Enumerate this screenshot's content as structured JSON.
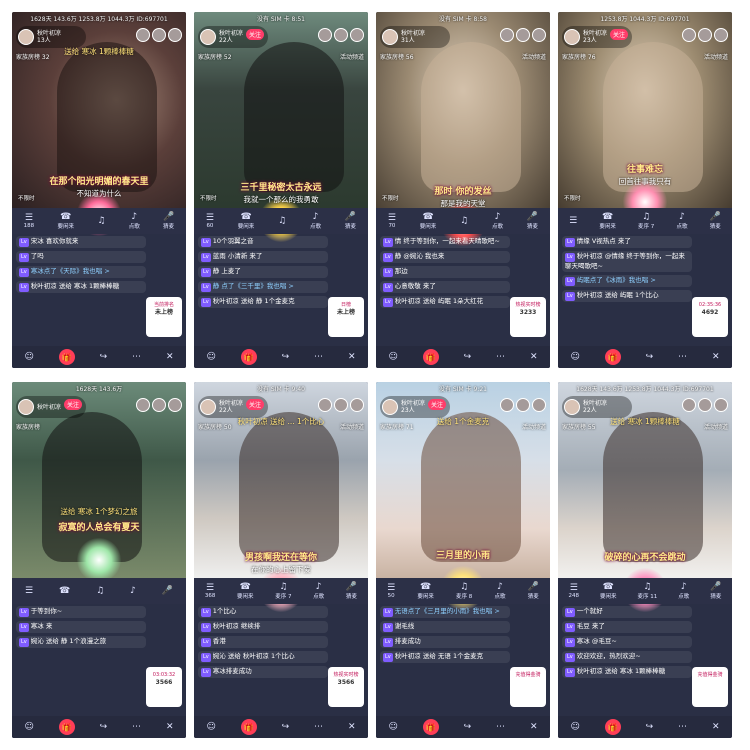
{
  "panels": [
    {
      "status": "1628天  143.6万  1253.8万  1044.3万  ID:697701",
      "streamer_name": "秋叶初凉",
      "streamer_sub": "13人",
      "follow": "",
      "rank": "家族房榜 32",
      "activity": "",
      "gift_banner": "送给 寒冰 1颗棒棒糖",
      "overlay_main": "在那个阳光明媚的春天里",
      "overlay_sub": "不知道为什么",
      "nodisturb": "不限时",
      "controls": [
        "188",
        "要闲来",
        "",
        "点歌",
        "猜麦"
      ],
      "chat": [
        "宋冰 喜欢你就来",
        "了吗",
        "寒冰点了《天际》我也唱 >",
        "秋叶初凉 送给 寒冰 1颗棒棒糖"
      ],
      "side_card": {
        "title": "当前排名",
        "value": "未上榜"
      }
    },
    {
      "status": "没有 SIM 卡 8:51",
      "streamer_name": "秋叶初凉",
      "streamer_sub": "22人",
      "follow": "关注",
      "rank": "家族房榜 52",
      "activity": "活动频道",
      "gift_banner": "",
      "overlay_main": "三千里秘密太古永远",
      "overlay_sub": "我就一个那么的我勇敢",
      "nodisturb": "不限时",
      "controls": [
        "60",
        "要闲来",
        "",
        "点歌",
        "猜麦"
      ],
      "chat": [
        "10个羽翼之音",
        "蓝雨 小清新 来了",
        "静 上麦了",
        "静 点了《三千里》我也唱 >",
        "秋叶初凉 送给 静 1个金麦克"
      ],
      "side_card": {
        "title": "日榜",
        "value": "未上榜"
      }
    },
    {
      "status": "没有 SIM 卡 8:58",
      "streamer_name": "秋叶初凉",
      "streamer_sub": "31人",
      "follow": "",
      "rank": "家族房榜 56",
      "activity": "活动频道",
      "gift_banner": "",
      "overlay_main": "那时 你的发丝",
      "overlay_sub": "那是我的天堂",
      "nodisturb": "不限时",
      "controls": [
        "70",
        "要闲来",
        "",
        "点歌",
        "猜麦"
      ],
      "chat": [
        "情 终于等到你，一起来看天晴歌吧~",
        "静 @婉沁 我也来",
        "那边",
        "心意敬敬 来了",
        "秋叶初凉 送给 屿眠 1朵大红花"
      ],
      "side_card": {
        "title": "热视实时榜",
        "value": "3233"
      }
    },
    {
      "status": "1253.8万  1044.3万  ID:697701",
      "streamer_name": "秋叶初凉",
      "streamer_sub": "23人",
      "follow": "关注",
      "rank": "家族房榜 76",
      "activity": "活动频道",
      "gift_banner": "",
      "overlay_main": "往事难忘",
      "overlay_sub": "回首往事我只有",
      "nodisturb": "不限时",
      "controls": [
        "",
        "要闲来",
        "麦序 7",
        "点歌",
        "猜麦"
      ],
      "chat": [
        "情缘 V视热点 来了",
        "秋叶初凉 @情缘 终于等到你，一起来聊天喝歌吧~",
        "屿眠点了《冰雨》我也唱 >",
        "秋叶初凉 送给 屿眠 1个比心"
      ],
      "side_card": {
        "title": "02:35:36",
        "value": "4692"
      }
    },
    {
      "status": "1628天  143.6万",
      "streamer_name": "秋叶初凉",
      "streamer_sub": "",
      "follow": "关注",
      "rank": "家族房榜",
      "activity": "",
      "gift_banner": "送给 寒冰 1个梦幻之旅",
      "overlay_main": "寂寞的人总会有夏天",
      "overlay_sub": "",
      "nodisturb": "",
      "controls": [
        "",
        "",
        "",
        "",
        ""
      ],
      "chat": [
        "于等到你~",
        "寒冰 来",
        "婉沁 送给 静 1个浪漫之旅"
      ],
      "side_card": {
        "title": "03:03:32",
        "value": "3566"
      }
    },
    {
      "status": "没有 SIM 卡 9:40",
      "streamer_name": "秋叶初凉",
      "streamer_sub": "22人",
      "follow": "关注",
      "rank": "家族房榜 50",
      "activity": "活动频道",
      "gift_banner": "秋叶初凉 送给 ... 1个比心",
      "overlay_main": "男孩啊我还在等你",
      "overlay_sub": "在你的心上留下爱",
      "nodisturb": "",
      "controls": [
        "368",
        "要闲来",
        "麦序 7",
        "点歌",
        "猜麦"
      ],
      "chat": [
        "1个比心",
        "秋叶初凉 继续排",
        "香港",
        "婉沁 送给 秋叶初凉 1个比心",
        "寒冰排麦成功"
      ],
      "side_card": {
        "title": "热视实时榜",
        "value": "3566"
      }
    },
    {
      "status": "没有 SIM 卡 9:21",
      "streamer_name": "秋叶初凉",
      "streamer_sub": "23人",
      "follow": "关注",
      "rank": "家族房榜 71",
      "activity": "活动频道",
      "gift_banner": "送给 1个金麦克",
      "overlay_main": "三月里的小雨",
      "overlay_sub": "",
      "nodisturb": "",
      "controls": [
        "50",
        "要闲来",
        "麦序 8",
        "点歌",
        "猜麦"
      ],
      "chat": [
        "无语点了《三月里的小雨》我也唱 >",
        "谢毛线",
        "排麦成功",
        "秋叶初凉 送给 无语 1个金麦克"
      ],
      "side_card": {
        "title": "充值得金骑",
        "value": ""
      }
    },
    {
      "status": "1628天  143.6万  1253.8万  1044.3万  ID:697701",
      "streamer_name": "秋叶初凉",
      "streamer_sub": "22人",
      "follow": "",
      "rank": "家族房榜 55",
      "activity": "活动频道",
      "gift_banner": "送给 寒冰 1颗棒棒糖",
      "overlay_main": "破碎的心再不会跳动",
      "overlay_sub": "",
      "nodisturb": "",
      "controls": [
        "248",
        "要闲来",
        "麦序 11",
        "点歌",
        "猜麦"
      ],
      "chat": [
        "一个就好",
        "毛豆 来了",
        "寒冰 @毛豆~",
        "欢迎欢迎，热烈欢迎~",
        "秋叶初凉 送给 寒冰 1颗棒棒糖"
      ],
      "side_card": {
        "title": "充值得金骑",
        "value": ""
      }
    }
  ],
  "icons": {
    "chat": "smile-icon",
    "gift": "gift-icon",
    "share": "share-icon",
    "more": "more-icon",
    "close": "close-icon"
  }
}
